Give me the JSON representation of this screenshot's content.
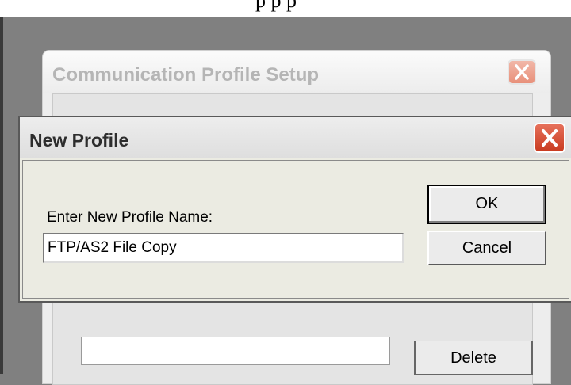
{
  "top_strip": {
    "text": "p p p"
  },
  "background_window": {
    "title": "Communication Profile Setup",
    "close_icon": "close-icon",
    "delete_label": "Delete"
  },
  "dialog": {
    "title": "New Profile",
    "close_icon": "close-icon",
    "prompt_label": "Enter New Profile Name:",
    "profile_name_value": "FTP/AS2 File Copy",
    "ok_label": "OK",
    "cancel_label": "Cancel"
  },
  "colors": {
    "desktop": "#808080",
    "dialog_bg": "#ebebe2",
    "active_close": "#c93b20",
    "inactive_close": "#e8907a"
  }
}
